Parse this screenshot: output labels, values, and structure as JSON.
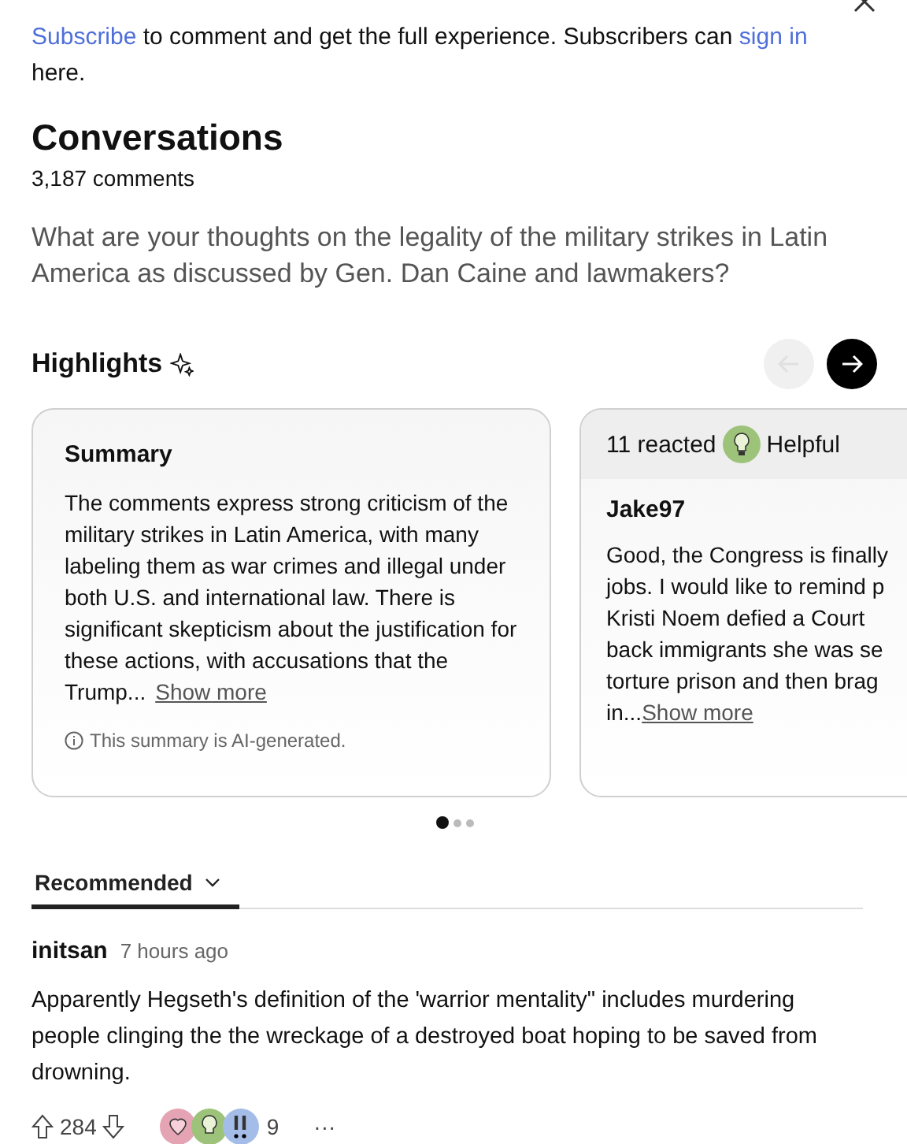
{
  "notice": {
    "link": "Subscribe",
    "middle": " to comment and get the full experience. Subscribers can ",
    "link2": "sign in",
    "end": " here."
  },
  "title": "Conversations",
  "count": "3,187 comments",
  "question": "What are your thoughts on the legality of the military strikes in Latin America as discussed by Gen. Dan Caine and lawmakers?",
  "highlights": {
    "title": "Highlights",
    "prev_disabled": true,
    "next_disabled": false,
    "cards": [
      {
        "kind": "summary",
        "title": "Summary",
        "text": "The comments express strong criticism of the military strikes in Latin America, with many labeling them as war crimes and illegal under both U.S. and international law. There is significant skepticism about the justification for these actions, with accusations that the Trump...",
        "more": "Show more",
        "note": "This summary is AI-generated."
      },
      {
        "kind": "comment",
        "reacted": "11 reacted",
        "reaction": "Helpful",
        "author": "Jake97",
        "lines": [
          "Good, the Congress is finally",
          "jobs. I would like to remind p",
          "Kristi Noem defied a Court",
          "back immigrants she was se",
          "torture prison and then brag"
        ],
        "last": "in...",
        "more": "Show more"
      }
    ],
    "dots": [
      {
        "selected": true
      },
      {
        "selected": false
      },
      {
        "selected": false
      }
    ]
  },
  "sort": {
    "label": "Recommended",
    "selected": true
  },
  "comments": [
    {
      "author": "initsan",
      "time": "7 hours ago",
      "text": "Apparently Hegseth's definition of the 'warrior mentality\" includes murdering people clinging the the wreckage of a destroyed boat hoping to be saved from drowning.",
      "votes": "284",
      "reactions": "9",
      "more": "···"
    }
  ]
}
